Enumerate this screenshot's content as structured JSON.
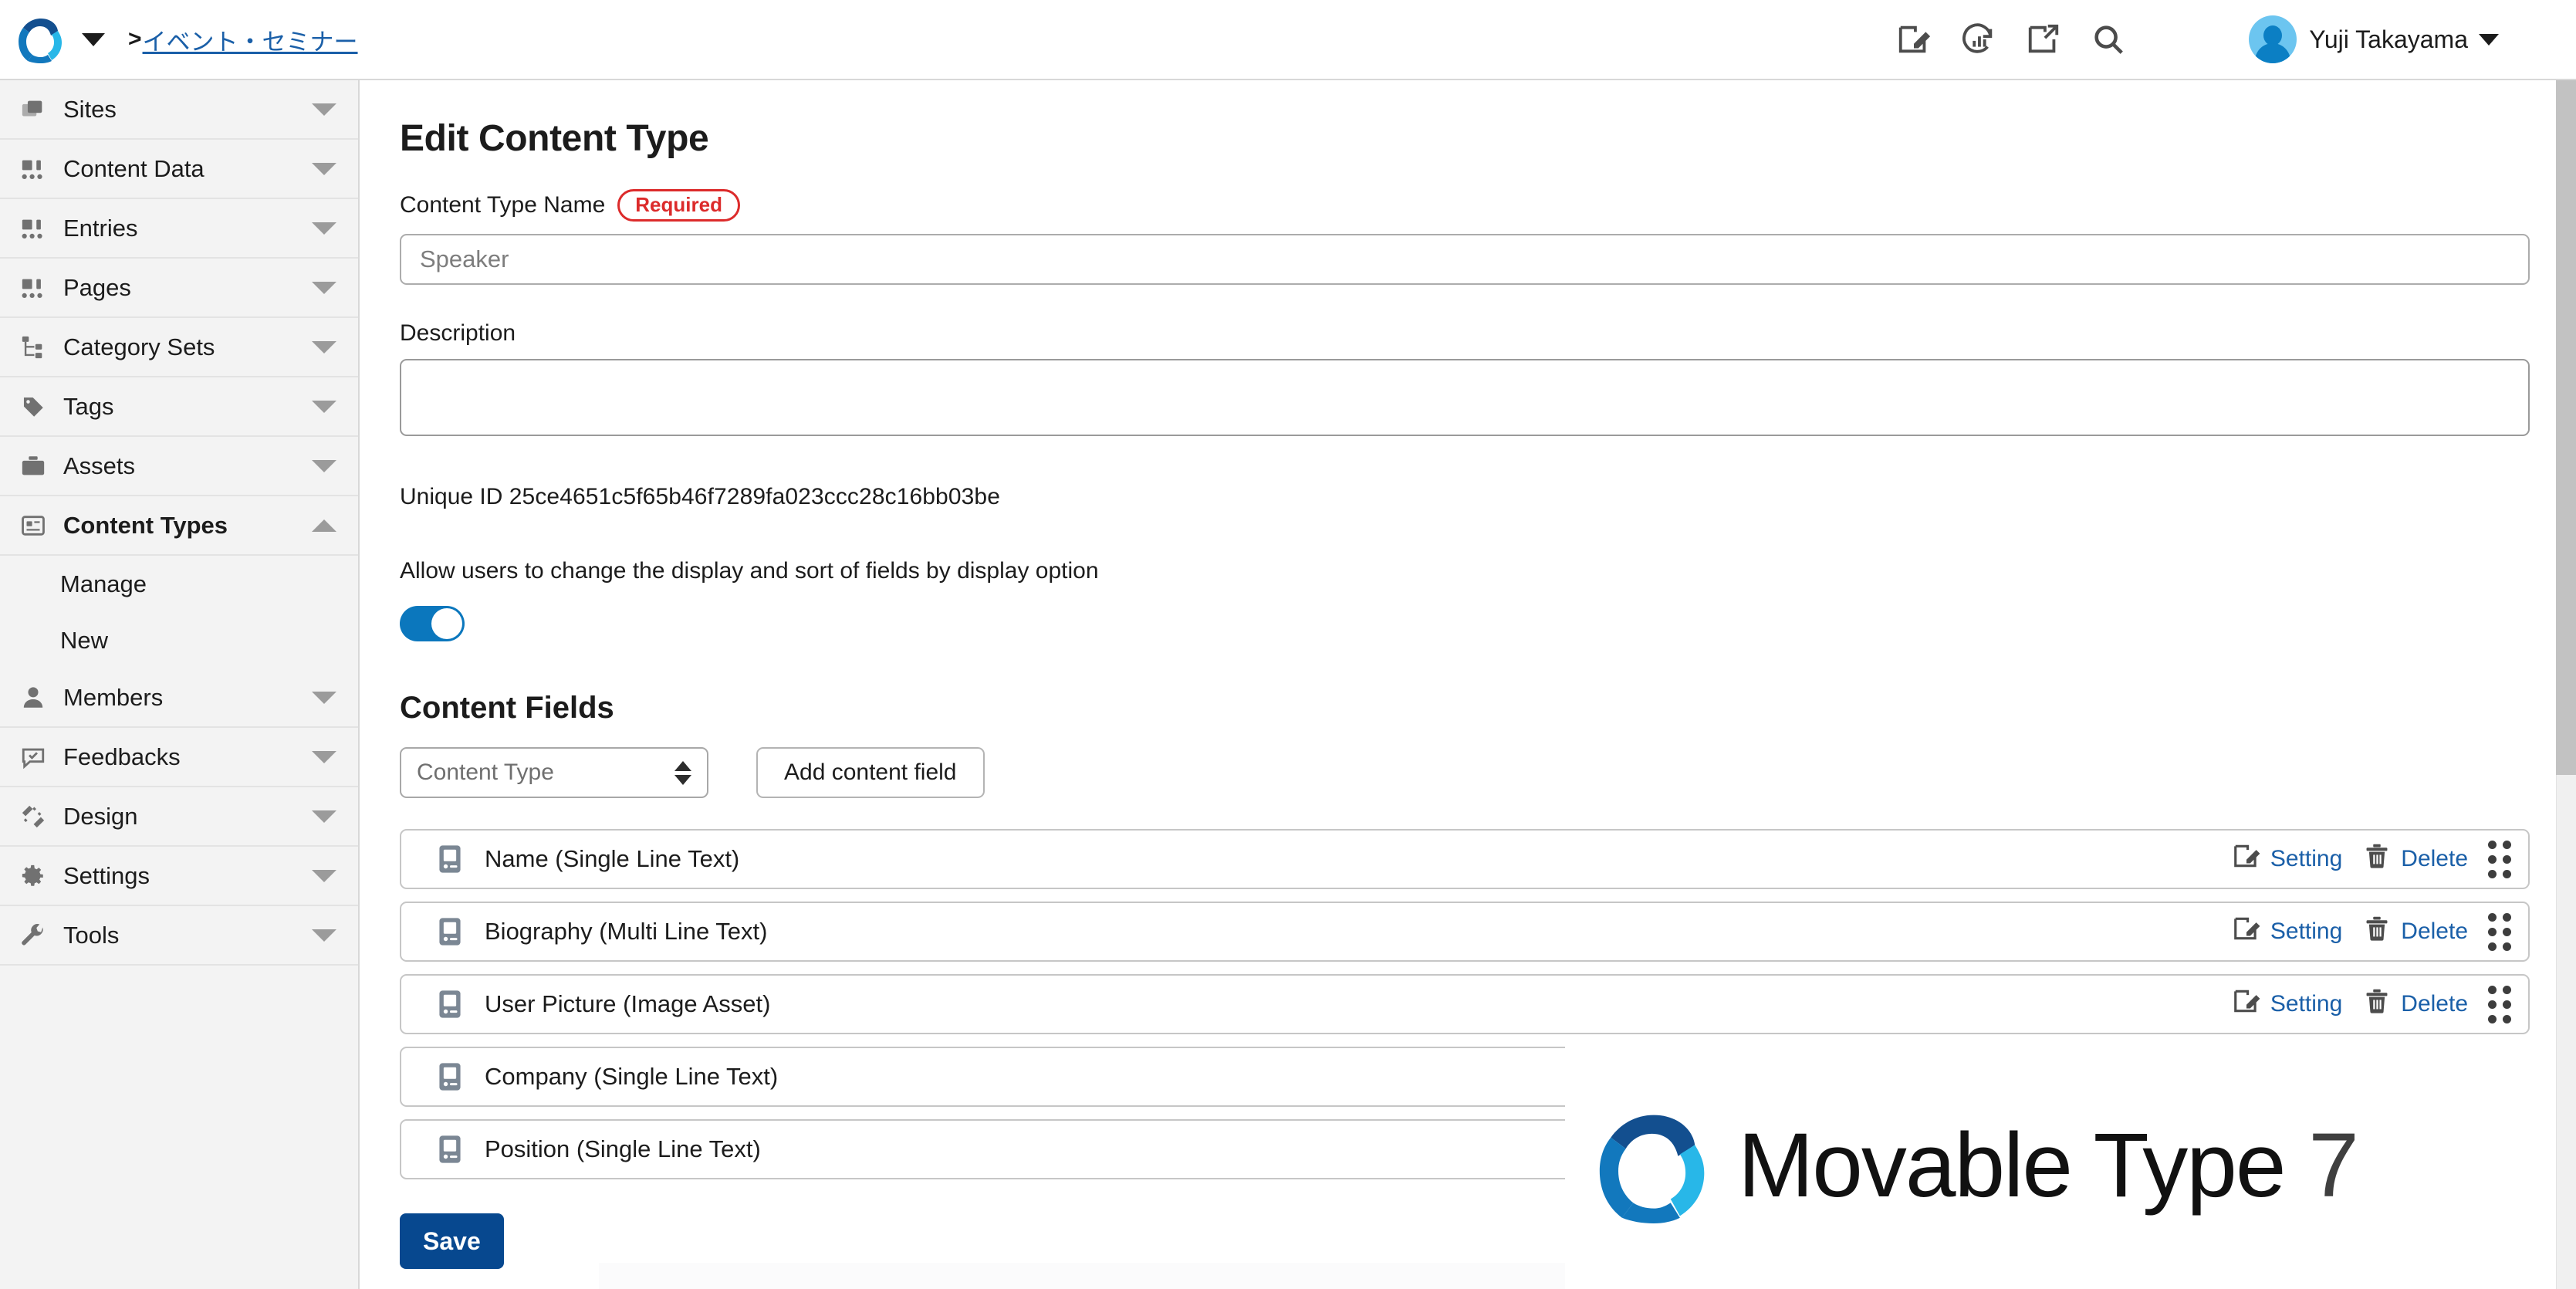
{
  "header": {
    "logo_name": "movable-type-logo",
    "breadcrumb": {
      "caret": "▼",
      "separator": ">",
      "site_name": "イベント・セミナー"
    },
    "icons": [
      {
        "name": "compose-entry-icon",
        "title": "Create Entry"
      },
      {
        "name": "rebuild-stats-icon",
        "title": "Rebuild"
      },
      {
        "name": "edit-external-icon",
        "title": "Edit"
      },
      {
        "name": "search-icon",
        "title": "Search"
      }
    ],
    "user": {
      "name": "Yuji Takayama",
      "caret": "▼"
    }
  },
  "sidebar": {
    "items": [
      {
        "label": "Sites",
        "icon": "sites-icon",
        "expanded": false,
        "active": false
      },
      {
        "label": "Content Data",
        "icon": "content-data-icon",
        "expanded": false,
        "active": false
      },
      {
        "label": "Entries",
        "icon": "entries-icon",
        "expanded": false,
        "active": false
      },
      {
        "label": "Pages",
        "icon": "pages-icon",
        "expanded": false,
        "active": false
      },
      {
        "label": "Category Sets",
        "icon": "category-sets-icon",
        "expanded": false,
        "active": false
      },
      {
        "label": "Tags",
        "icon": "tags-icon",
        "expanded": false,
        "active": false
      },
      {
        "label": "Assets",
        "icon": "assets-icon",
        "expanded": false,
        "active": false
      },
      {
        "label": "Content Types",
        "icon": "content-types-icon",
        "expanded": true,
        "active": true
      },
      {
        "label": "Members",
        "icon": "members-icon",
        "expanded": false,
        "active": false
      },
      {
        "label": "Feedbacks",
        "icon": "feedbacks-icon",
        "expanded": false,
        "active": false
      },
      {
        "label": "Design",
        "icon": "design-icon",
        "expanded": false,
        "active": false
      },
      {
        "label": "Settings",
        "icon": "settings-icon",
        "expanded": false,
        "active": false
      },
      {
        "label": "Tools",
        "icon": "tools-icon",
        "expanded": false,
        "active": false
      }
    ],
    "subitems": [
      {
        "label": "Manage"
      },
      {
        "label": "New"
      }
    ]
  },
  "main": {
    "page_title": "Edit Content Type",
    "content_type_name": {
      "label": "Content Type Name",
      "required_badge": "Required",
      "value": "Speaker",
      "placeholder": "Speaker"
    },
    "description": {
      "label": "Description",
      "value": "",
      "placeholder": ""
    },
    "unique_id": {
      "label": "Unique ID",
      "value": "25ce4651c5f65b46f7289fa023ccc28c16bb03be"
    },
    "allow_display_option": {
      "label": "Allow users to change the display and sort of fields by display option",
      "enabled": true
    },
    "content_fields": {
      "title": "Content Fields",
      "select_value": "Content Type",
      "add_button": "Add content field",
      "action_setting_label": "Setting",
      "action_delete_label": "Delete",
      "rows": [
        {
          "name": "Name (Single Line Text)"
        },
        {
          "name": "Biography (Multi Line Text)"
        },
        {
          "name": "User Picture (Image Asset)"
        },
        {
          "name": "Company (Single Line Text)"
        },
        {
          "name": "Position (Single Line Text)"
        }
      ]
    },
    "save_button": "Save"
  },
  "watermark": {
    "product": "Movable Type",
    "version": "7"
  },
  "colors": {
    "link_blue": "#1a5fa8",
    "required_red": "#dc2b2b",
    "toggle_on": "#0b77bd",
    "save_blue": "#07488f",
    "sidebar_bg": "#f3f3f3",
    "logo_dark_blue": "#134f8f",
    "logo_mid_blue": "#1278bd",
    "logo_light_blue": "#28b7e8"
  }
}
